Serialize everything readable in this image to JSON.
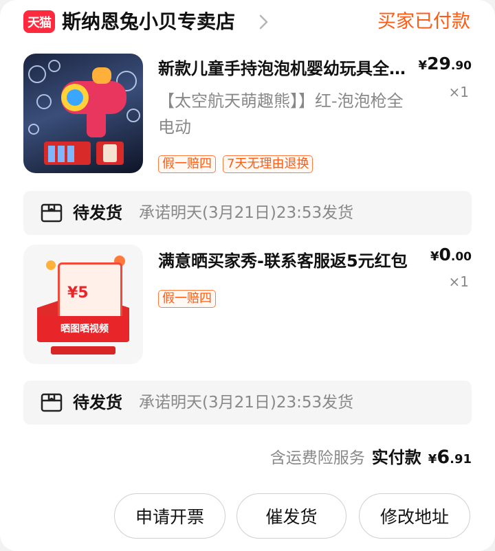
{
  "store": {
    "logo_text": "天猫",
    "name": "斯纳恩兔小贝专卖店",
    "order_status": "买家已付款"
  },
  "items": [
    {
      "title": "新款儿童手持泡泡机婴幼玩具全自动吹泡泡",
      "sku": "【太空航天萌趣熊】】红-泡泡枪全电动",
      "price": {
        "currency": "¥",
        "integer": "29",
        "decimal": ".90"
      },
      "quantity": "×1",
      "tags": [
        "假一赔四",
        "7天无理由退换"
      ],
      "shipping": {
        "status": "待发货",
        "promise": "承诺明天(3月21日)23:53发货"
      }
    },
    {
      "title": "满意晒买家秀-联系客服返5元红包",
      "sku": "",
      "price": {
        "currency": "¥",
        "integer": "0",
        "decimal": ".00"
      },
      "quantity": "×1",
      "tags": [
        "假一赔四"
      ],
      "shipping": {
        "status": "待发货",
        "promise": "承诺明天(3月21日)23:53发货"
      }
    }
  ],
  "promo_image": {
    "amount": "¥5",
    "caption": "晒图晒视频"
  },
  "summary": {
    "note": "含运费险服务",
    "label": "实付款",
    "amount": {
      "currency": "¥",
      "integer": "6",
      "decimal": ".91"
    }
  },
  "actions": {
    "invoice": "申请开票",
    "urge_shipping": "催发货",
    "change_address": "修改地址"
  },
  "colors": {
    "accent": "#ff5b14",
    "brand": "#ff2a3d"
  }
}
